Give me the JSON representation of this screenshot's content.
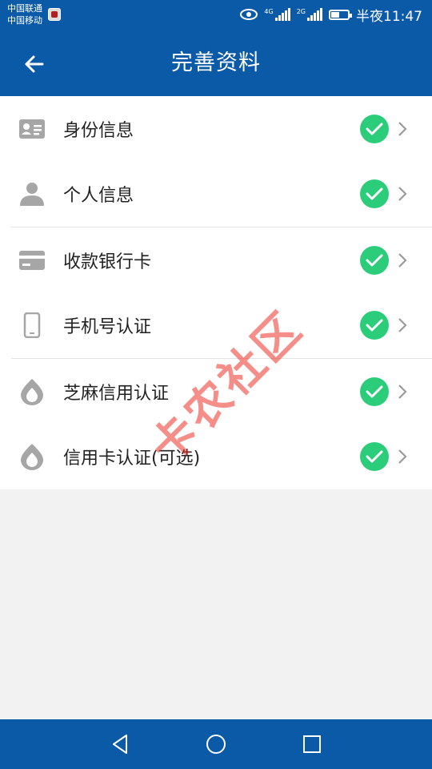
{
  "status_bar": {
    "carrier_1": "中国联通",
    "carrier_2": "中国移动",
    "sig1_tag": "4G",
    "sig2_tag": "2G",
    "time": "半夜11:47"
  },
  "header": {
    "title": "完善资料",
    "back_icon": "arrow-left-icon"
  },
  "items": [
    {
      "label": "身份信息",
      "icon": "id-card-icon",
      "status": "completed"
    },
    {
      "label": "个人信息",
      "icon": "person-icon",
      "status": "completed"
    },
    {
      "label": "收款银行卡",
      "icon": "bank-card-icon",
      "status": "completed"
    },
    {
      "label": "手机号认证",
      "icon": "phone-icon",
      "status": "completed"
    },
    {
      "label": "芝麻信用认证",
      "icon": "sesame-credit-icon",
      "status": "completed"
    },
    {
      "label": "信用卡认证(可选)",
      "icon": "credit-card-drop-icon",
      "status": "completed"
    }
  ],
  "watermark": "卡农社区",
  "colors": {
    "brand": "#0b5aa8",
    "check": "#2bcc7a",
    "icon_gray": "#a6a6a6",
    "watermark": "#ec3228"
  },
  "nav": {
    "back_icon": "triangle-back-icon",
    "home_icon": "circle-home-icon",
    "recents_icon": "square-recents-icon"
  }
}
